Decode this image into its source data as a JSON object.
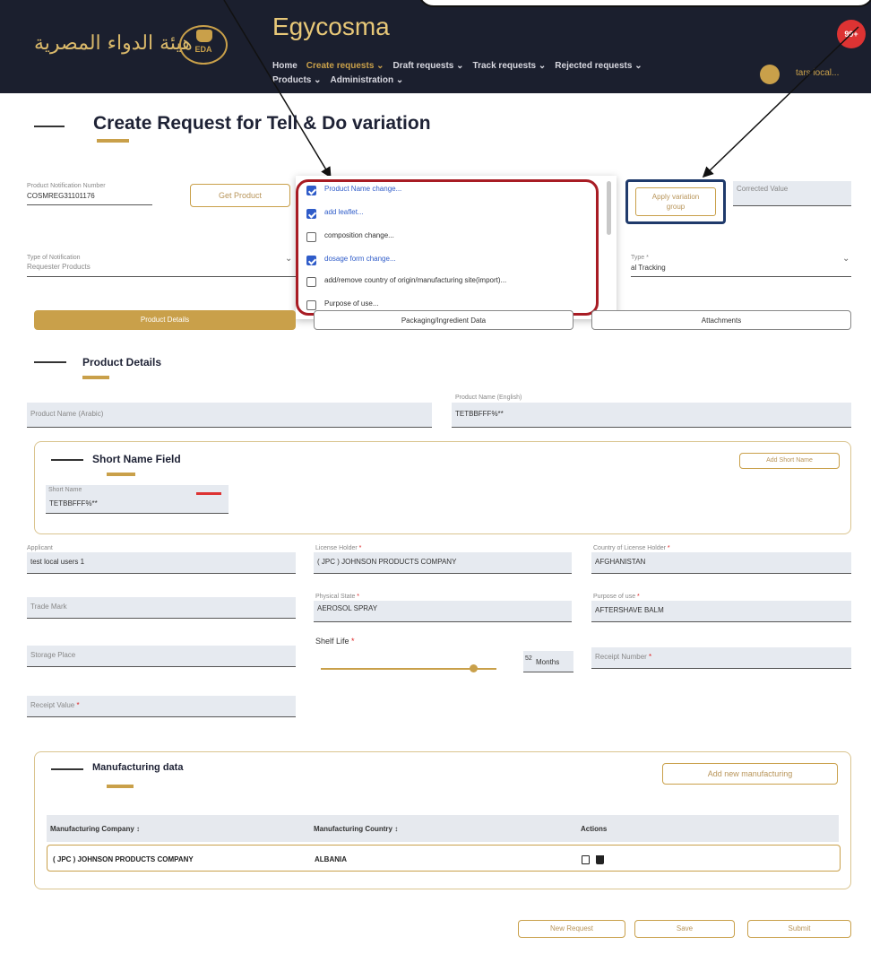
{
  "header": {
    "brand_ar": "هيئة الدواء المصرية",
    "logo_text": "EDA",
    "app_title": "Egycosma",
    "nav": [
      {
        "label": "Home",
        "active": false
      },
      {
        "label": "Create requests ⌄",
        "active": true
      },
      {
        "label": "Draft requests ⌄",
        "active": false
      },
      {
        "label": "Track requests ⌄",
        "active": false
      },
      {
        "label": "Rejected requests ⌄",
        "active": false
      },
      {
        "label": "Products ⌄",
        "active": false
      },
      {
        "label": "Administration ⌄",
        "active": false
      }
    ],
    "user_name": "tars local...",
    "notification_badge": "99+"
  },
  "page": {
    "title": "Create Request for Tell & Do variation"
  },
  "top_form": {
    "notification_number_label": "Product Notification Number",
    "notification_number_value": "COSMREG31101176",
    "get_product_label": "Get Product",
    "corrected_value_placeholder": "Corrected Value",
    "type_label": "Type of Notification",
    "type_value": "Requester Products",
    "tracking_label": "Type *",
    "tracking_value": "al Tracking"
  },
  "variation_dropdown": {
    "options": [
      {
        "label": "Product Name change...",
        "checked": true
      },
      {
        "label": "add leaflet...",
        "checked": true
      },
      {
        "label": "composition change...",
        "checked": false
      },
      {
        "label": "dosage form change...",
        "checked": true
      },
      {
        "label": "add/remove country of origin/manufacturing site(import)...",
        "checked": false
      },
      {
        "label": "Purpose of use...",
        "checked": false
      }
    ]
  },
  "apply_button": {
    "line1": "Apply variation",
    "line2": "group"
  },
  "tabs": [
    {
      "label": "Product Details",
      "active": true
    },
    {
      "label": "Packaging/Ingredient Data",
      "active": false
    },
    {
      "label": "Attachments",
      "active": false
    }
  ],
  "product_details": {
    "section_title": "Product Details",
    "name_arabic_placeholder": "Product Name (Arabic)",
    "name_english_label": "Product Name (English)",
    "name_english_value": "TETBBFFF%**"
  },
  "short_name": {
    "section_title": "Short Name Field",
    "add_button": "Add Short Name",
    "field_label": "Short Name",
    "field_value": "TETBBFFF%**"
  },
  "grid_fields": {
    "applicant_label": "Applicant",
    "applicant_value": "test local users 1",
    "license_label": "License Holder",
    "license_value": "( JPC ) JOHNSON PRODUCTS COMPANY",
    "country_label": "Country of License Holder",
    "country_value": "AFGHANISTAN",
    "trademark_placeholder": "Trade Mark",
    "physical_label": "Physical State",
    "physical_value": "AEROSOL SPRAY",
    "purpose_label": "Purpose of use",
    "purpose_value": "AFTERSHAVE BALM",
    "storage_placeholder": "Storage Place",
    "shelf_life_label": "Shelf Life",
    "shelf_life_number": "52",
    "shelf_life_unit": "Months",
    "receipt_number_placeholder": "Receipt Number",
    "receipt_value_placeholder": "Receipt Value"
  },
  "manufacturing": {
    "section_title": "Manufacturing data",
    "add_button": "Add new manufacturing",
    "columns": [
      "Manufacturing Company ↕",
      "Manufacturing Country ↕",
      "Actions"
    ],
    "rows": [
      {
        "company": "( JPC ) JOHNSON PRODUCTS COMPANY",
        "country": "ALBANIA"
      }
    ]
  },
  "footer_buttons": {
    "new_request": "New Request",
    "save": "Save",
    "submit": "Submit"
  }
}
